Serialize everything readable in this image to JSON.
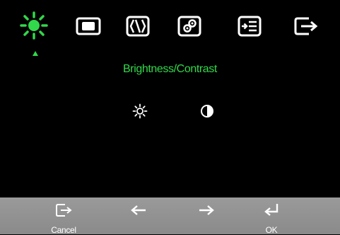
{
  "osd": {
    "colors": {
      "background": "#000000",
      "accent": "#31d84a",
      "icon": "#ffffff",
      "footer": "#929292"
    },
    "tabs": [
      {
        "icon": "brightness-icon",
        "selected": true
      },
      {
        "icon": "image-position-icon",
        "selected": false
      },
      {
        "icon": "image-setup-icon",
        "selected": false
      },
      {
        "icon": "image-properties-icon",
        "selected": false
      },
      {
        "icon": "options-icon",
        "selected": false
      },
      {
        "icon": "exit-icon",
        "selected": false
      }
    ],
    "menu_title": "Brightness/Contrast",
    "submenu_icons": [
      "sun-icon",
      "contrast-icon"
    ],
    "footer_keys": [
      {
        "icon": "exit-icon",
        "label": "Cancel"
      },
      {
        "icon": "left-arrow-icon",
        "label": ""
      },
      {
        "icon": "right-arrow-icon",
        "label": ""
      },
      {
        "icon": "enter-icon",
        "label": "OK"
      }
    ]
  }
}
